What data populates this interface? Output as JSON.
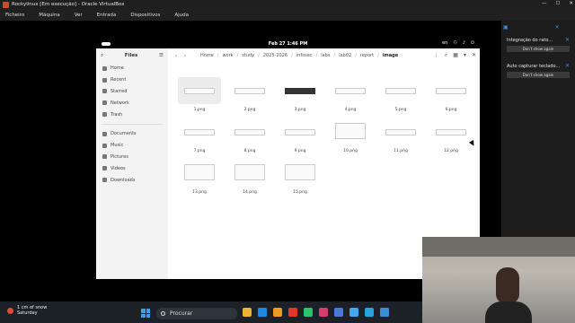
{
  "window": {
    "title": "Rockylinux [Em execução] - Oracle VirtualBox",
    "controls": [
      "—",
      "☐",
      "✕"
    ]
  },
  "menu": [
    "Ficheiro",
    "Máquina",
    "Ver",
    "Entrada",
    "Dispositivos",
    "Ajuda"
  ],
  "notifications": [
    {
      "text": "Integração do rato...",
      "button": "Don't show again"
    },
    {
      "text": "Auto capturar teclado...",
      "button": "Don't show again"
    }
  ],
  "gnome": {
    "clock": "Feb 27   1:46 PM",
    "tray": [
      "en",
      "⚇",
      "♪",
      "⏻"
    ]
  },
  "files": {
    "title": "Files",
    "sidebar": [
      "Home",
      "Recent",
      "Starred",
      "Network",
      "Trash"
    ],
    "sidebar2": [
      "Documents",
      "Music",
      "Pictures",
      "Videos",
      "Downloads"
    ],
    "path": [
      "Home",
      "work",
      "study",
      "2025-2026",
      "infosec",
      "labs",
      "lab02",
      "report",
      "image"
    ],
    "items": [
      "1.png",
      "2.png",
      "3.png",
      "4.png",
      "5.png",
      "6.png",
      "7.png",
      "8.png",
      "9.png",
      "10.png",
      "11.png",
      "12.png",
      "13.png",
      "14.png",
      "15.png"
    ]
  },
  "taskbar": {
    "weather_line1": "1 cm of snow",
    "weather_line2": "Saturday",
    "search": "Procurar"
  },
  "colors": {
    "accent": "#3c8cf0",
    "vbox": "#d04a2a"
  }
}
